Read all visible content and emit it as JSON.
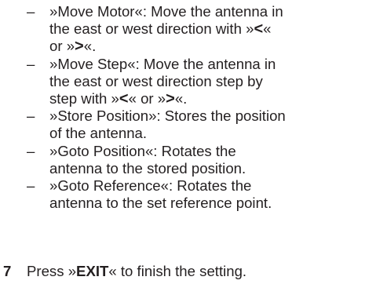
{
  "items": [
    {
      "dash": "–",
      "line1_a": "»Move Motor«: Move the antenna in",
      "line2_a": "the east or west direction with »",
      "arrow_left": "<",
      "line2_b": "«",
      "line3_a": "or »",
      "arrow_right": ">",
      "line3_b": "«."
    },
    {
      "dash": "–",
      "line1_a": "»Move Step«: Move the antenna in",
      "line2_a": "the east or west direction step by",
      "line3_a": "step with »",
      "arrow_left": "<",
      "line3_b": "« or »",
      "arrow_right": ">",
      "line3_c": "«."
    },
    {
      "dash": "–",
      "line1_a": "»Store Position»: Stores the position",
      "line2_a": "of the antenna."
    },
    {
      "dash": "–",
      "line1_a": "»Goto Position«: Rotates the",
      "line2_a": "antenna to the stored position."
    },
    {
      "dash": "–",
      "line1_a": "»Goto Reference«: Rotates the",
      "line2_a": "antenna to the set reference point."
    }
  ],
  "step": {
    "number": "7",
    "text_a": "Press »",
    "key": "EXIT",
    "text_b": "« to finish the setting."
  }
}
